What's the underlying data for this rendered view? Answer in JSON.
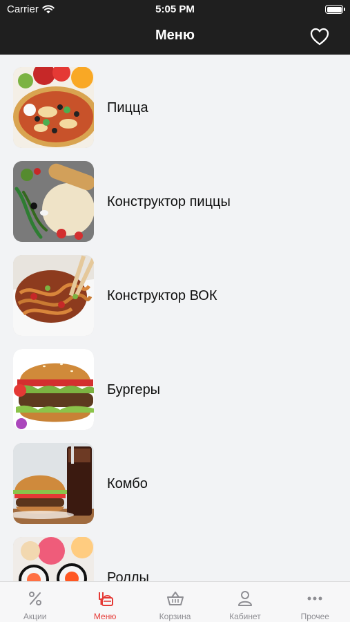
{
  "status": {
    "carrier": "Carrier",
    "time": "5:05 PM",
    "battery_level": 1.0
  },
  "header": {
    "title": "Меню"
  },
  "menu": {
    "items": [
      {
        "label": "Пицца",
        "image": "pizza"
      },
      {
        "label": "Конструктор пиццы",
        "image": "pizza-ingredients"
      },
      {
        "label": "Конструктор ВОК",
        "image": "wok-noodles"
      },
      {
        "label": "Бургеры",
        "image": "burger"
      },
      {
        "label": "Комбо",
        "image": "combo"
      },
      {
        "label": "Роллы",
        "image": "rolls"
      }
    ]
  },
  "tabs": [
    {
      "label": "Акции",
      "icon": "percent-icon",
      "active": false
    },
    {
      "label": "Меню",
      "icon": "menu-icon",
      "active": true
    },
    {
      "label": "Корзина",
      "icon": "basket-icon",
      "active": false
    },
    {
      "label": "Кабинет",
      "icon": "person-icon",
      "active": false
    },
    {
      "label": "Прочее",
      "icon": "more-icon",
      "active": false
    }
  ],
  "colors": {
    "accent": "#e53935",
    "header_bg": "#1f1f1f",
    "tab_inactive": "#8e8e93",
    "background": "#f2f3f5"
  }
}
